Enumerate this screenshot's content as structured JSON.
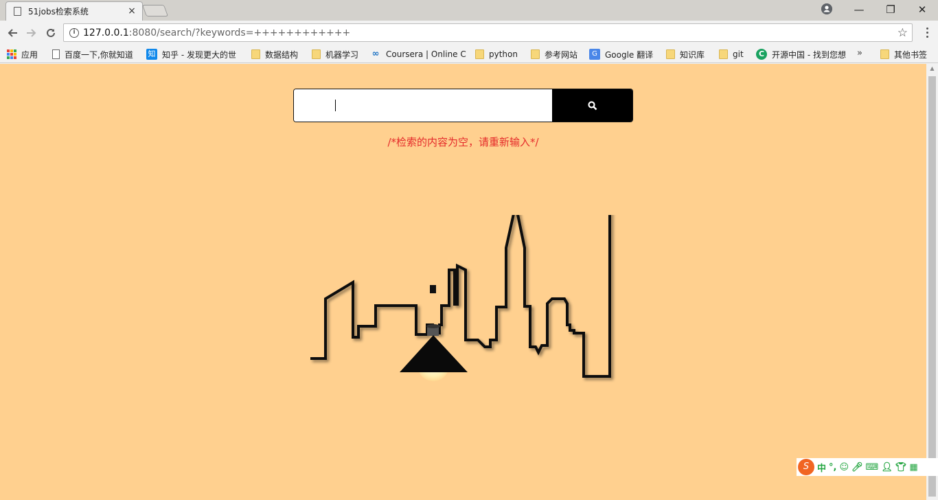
{
  "tab": {
    "title": "51jobs检索系统",
    "close": "×"
  },
  "window": {
    "minimize": "—",
    "restore": "❐",
    "close": "✕",
    "profile": "●"
  },
  "address": {
    "host": "127.0.0.1",
    "rest": ":8080/search/?keywords=++++++++++++"
  },
  "bookmarks": [
    {
      "label": "应用",
      "icon": "apps-grid-icon"
    },
    {
      "label": "百度一下,你就知道",
      "icon": "page-icon"
    },
    {
      "label": "知乎 - 发现更大的世",
      "icon": "zhihu-icon",
      "glyph": "知"
    },
    {
      "label": "数据结构",
      "icon": "folder-icon"
    },
    {
      "label": "机器学习",
      "icon": "folder-icon"
    },
    {
      "label": "Coursera | Online C",
      "icon": "coursera-icon",
      "glyph": "∞"
    },
    {
      "label": "python",
      "icon": "folder-icon"
    },
    {
      "label": "参考网站",
      "icon": "folder-icon"
    },
    {
      "label": "Google 翻译",
      "icon": "google-translate-icon",
      "glyph": "G"
    },
    {
      "label": "知识库",
      "icon": "folder-icon"
    },
    {
      "label": "git",
      "icon": "folder-icon"
    },
    {
      "label": "开源中国 - 找到您想",
      "icon": "oschina-icon",
      "glyph": "C"
    },
    {
      "label": "其他书签",
      "icon": "folder-icon"
    }
  ],
  "bookmarks_more": "»",
  "search": {
    "value": ""
  },
  "error": "/*检索的内容为空，请重新输入*/",
  "ime": {
    "logo": "S",
    "mode": "中",
    "punct": "°,"
  },
  "colors": {
    "page_bg": "#ffd08f",
    "error": "#e52a2a",
    "button": "#000000"
  }
}
